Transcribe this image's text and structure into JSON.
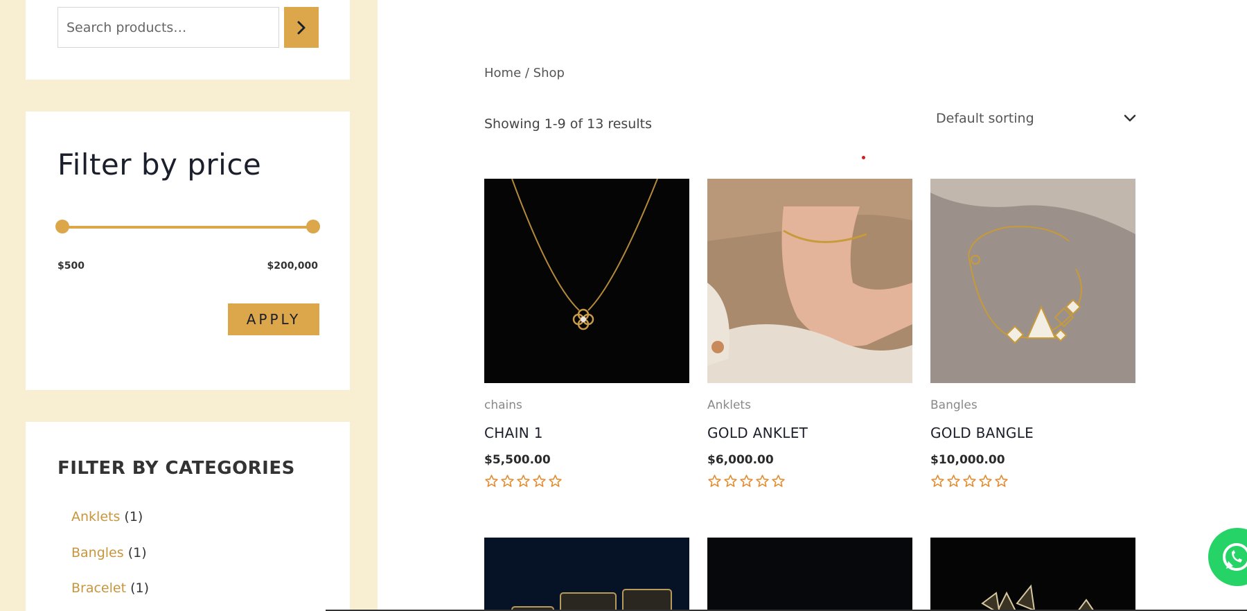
{
  "search": {
    "placeholder": "Search products…"
  },
  "price_filter": {
    "title": "Filter by price",
    "min_label": "$500",
    "max_label": "$200,000",
    "range_min_fraction": 0.0,
    "range_max_fraction": 1.0,
    "apply_label": "APPLY"
  },
  "categories": {
    "title": "FILTER BY CATEGORIES",
    "items": [
      {
        "name": "Anklets",
        "count": "(1)"
      },
      {
        "name": "Bangles",
        "count": "(1)"
      },
      {
        "name": "Bracelet",
        "count": "(1)"
      }
    ]
  },
  "breadcrumb": "Home / Shop",
  "result_count": "Showing 1-9 of 13 results",
  "sorting": {
    "selected": "Default sorting"
  },
  "products": [
    {
      "category": "chains",
      "title": "CHAIN 1",
      "price": "$5,500.00",
      "rating": 0,
      "max_rating": 5
    },
    {
      "category": "Anklets",
      "title": "GOLD ANKLET",
      "price": "$6,000.00",
      "rating": 0,
      "max_rating": 5
    },
    {
      "category": "Bangles",
      "title": "GOLD BANGLE",
      "price": "$10,000.00",
      "rating": 0,
      "max_rating": 5
    }
  ],
  "colors": {
    "accent": "#dca64a",
    "sidebar_bg": "#f8efd3",
    "category_link": "#c9953c",
    "star": "#e58a2c",
    "whatsapp": "#25d366"
  },
  "icons": {
    "search_button": "chevron-right-icon",
    "sort": "chevron-down-icon",
    "star": "star-outline-icon",
    "chat": "whatsapp-icon"
  }
}
